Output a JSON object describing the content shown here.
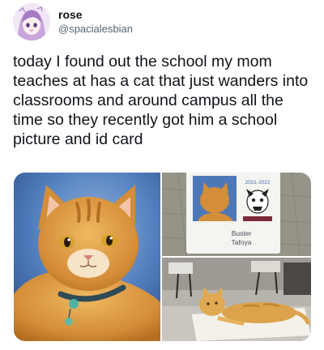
{
  "tweet": {
    "author": {
      "display_name": "rose",
      "handle": "@spacialesbian"
    },
    "text": "today I found out the school my mom teaches at has a cat that just wanders into classrooms and around campus all the time so they recently got him a school picture and id card",
    "media": {
      "id_card": {
        "year": "2021-2022",
        "first_name": "Buster",
        "last_name": "Tafoya"
      }
    }
  },
  "colors": {
    "text_primary": "#0f1419",
    "text_secondary": "#536471",
    "portrait_backdrop": "#3f6fb3",
    "cat_orange": "#d9963f"
  },
  "icons": {
    "avatar": "anime-girl-avatar"
  }
}
